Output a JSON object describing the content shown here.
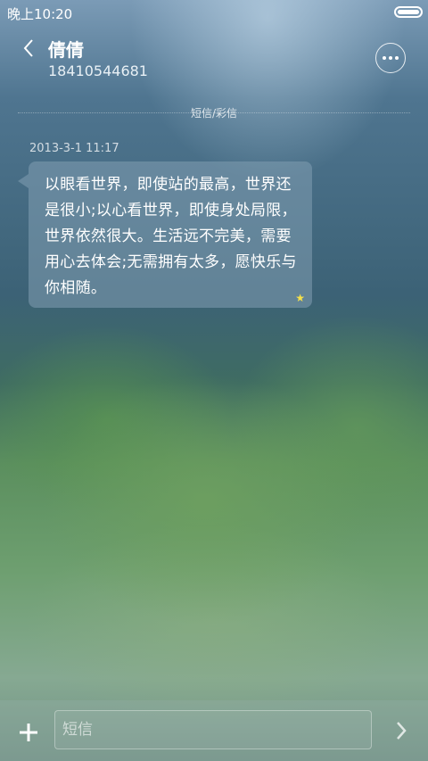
{
  "status_bar": {
    "time": "晚上10:20"
  },
  "header": {
    "contact_name": "倩倩",
    "contact_number": "18410544681"
  },
  "conversation": {
    "type_label": "短信/彩信",
    "messages": [
      {
        "timestamp": "2013-3-1 11:17",
        "text": "以眼看世界，即使站的最高，世界还是很小;以心看世界，即使身处局限，世界依然很大。生活远不完美，需要用心去体会;无需拥有太多，愿快乐与你相随。",
        "starred": true,
        "star_symbol": "★"
      }
    ]
  },
  "composer": {
    "placeholder": "短信"
  },
  "colors": {
    "star": "#f5e14a"
  },
  "icons": {
    "back": "chevron-left-icon",
    "more": "more-dots-icon",
    "add": "plus-icon",
    "send": "chevron-right-icon",
    "battery": "battery-icon",
    "star": "star-icon"
  }
}
